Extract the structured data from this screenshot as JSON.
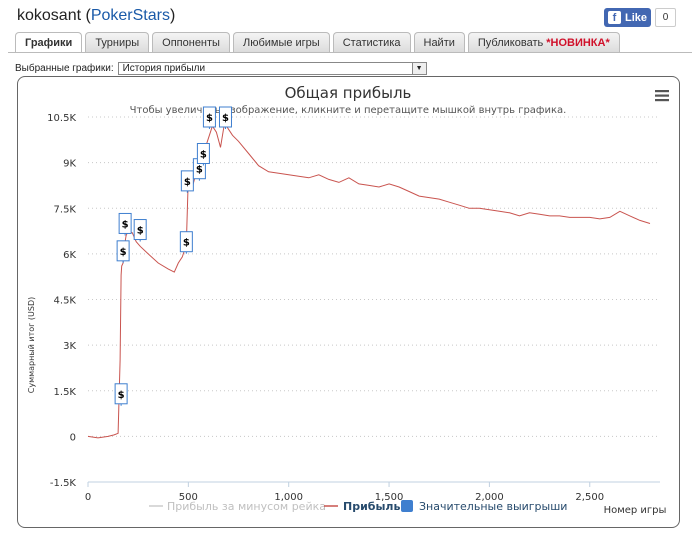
{
  "header": {
    "player_name": "kokosant",
    "site_name": "PokerStars",
    "fb_like_label": "Like",
    "fb_like_count": "0"
  },
  "tabs": [
    {
      "label": "Графики",
      "active": true
    },
    {
      "label": "Турниры"
    },
    {
      "label": "Оппоненты"
    },
    {
      "label": "Любимые игры"
    },
    {
      "label": "Статистика"
    },
    {
      "label": "Найти"
    },
    {
      "label": "Публиковать",
      "badge": "*НОВИНКА*"
    }
  ],
  "selector": {
    "label": "Выбранные графики:",
    "value": "История прибыли"
  },
  "chart_data": {
    "type": "line",
    "title": "Общая прибыль",
    "subtitle": "Чтобы увеличить изображение, кликните и перетащите мышкой внутрь графика.",
    "xlabel": "Номер игры",
    "ylabel": "Суммарный итог (USD)",
    "xlim": [
      0,
      2850
    ],
    "ylim": [
      -1500,
      10500
    ],
    "x_ticks": [
      0,
      500,
      1000,
      1500,
      2000,
      2500
    ],
    "x_tick_labels": [
      "0",
      "500",
      "1,000",
      "1,500",
      "2,000",
      "2,500"
    ],
    "y_ticks": [
      -1500,
      0,
      1500,
      3000,
      4500,
      6000,
      7500,
      9000,
      10500
    ],
    "y_tick_labels": [
      "-1.5K",
      "0",
      "1.5K",
      "3K",
      "4.5K",
      "6K",
      "7.5K",
      "9K",
      "10.5K"
    ],
    "grid": "horizontal dotted",
    "legend": "bottom",
    "series": [
      {
        "name": "Прибыль за минусом рейка",
        "color": "#cccccc",
        "values": []
      },
      {
        "name": "Прибыль",
        "color": "#c9544f",
        "x": [
          0,
          50,
          100,
          130,
          150,
          160,
          165,
          168,
          175,
          180,
          190,
          200,
          220,
          240,
          260,
          300,
          350,
          400,
          430,
          450,
          470,
          480,
          490,
          495,
          500,
          505,
          510,
          520,
          540,
          560,
          580,
          600,
          620,
          640,
          660,
          680,
          700,
          720,
          750,
          800,
          850,
          900,
          950,
          1000,
          1050,
          1100,
          1150,
          1200,
          1250,
          1300,
          1350,
          1400,
          1450,
          1500,
          1550,
          1600,
          1650,
          1700,
          1750,
          1800,
          1850,
          1900,
          1950,
          2000,
          2050,
          2100,
          2150,
          2200,
          2250,
          2300,
          2350,
          2400,
          2450,
          2500,
          2550,
          2600,
          2650,
          2700,
          2750,
          2800
        ],
        "values": [
          0,
          -50,
          0,
          50,
          100,
          2500,
          5300,
          5600,
          5700,
          6200,
          6600,
          6750,
          6700,
          6400,
          6250,
          6000,
          5700,
          5500,
          5400,
          5700,
          5900,
          6100,
          6300,
          7400,
          8600,
          8300,
          8100,
          8200,
          8700,
          9100,
          9400,
          9800,
          10200,
          10000,
          9500,
          10300,
          10100,
          9900,
          9700,
          9300,
          8900,
          8700,
          8650,
          8600,
          8550,
          8500,
          8600,
          8450,
          8350,
          8500,
          8300,
          8250,
          8200,
          8300,
          8200,
          8050,
          7900,
          7850,
          7800,
          7700,
          7600,
          7500,
          7500,
          7450,
          7400,
          7350,
          7250,
          7350,
          7300,
          7250,
          7250,
          7200,
          7200,
          7200,
          7150,
          7200,
          7400,
          7250,
          7100,
          7000
        ]
      },
      {
        "name": "Значительные выигрыши",
        "color": "#3f7fcf",
        "marker": "$",
        "x": [
          165,
          175,
          185,
          260,
          490,
          495,
          555,
          575,
          605,
          685
        ],
        "values": [
          1400,
          6100,
          7000,
          6800,
          6400,
          8400,
          8800,
          9300,
          10500,
          10500
        ]
      }
    ]
  }
}
